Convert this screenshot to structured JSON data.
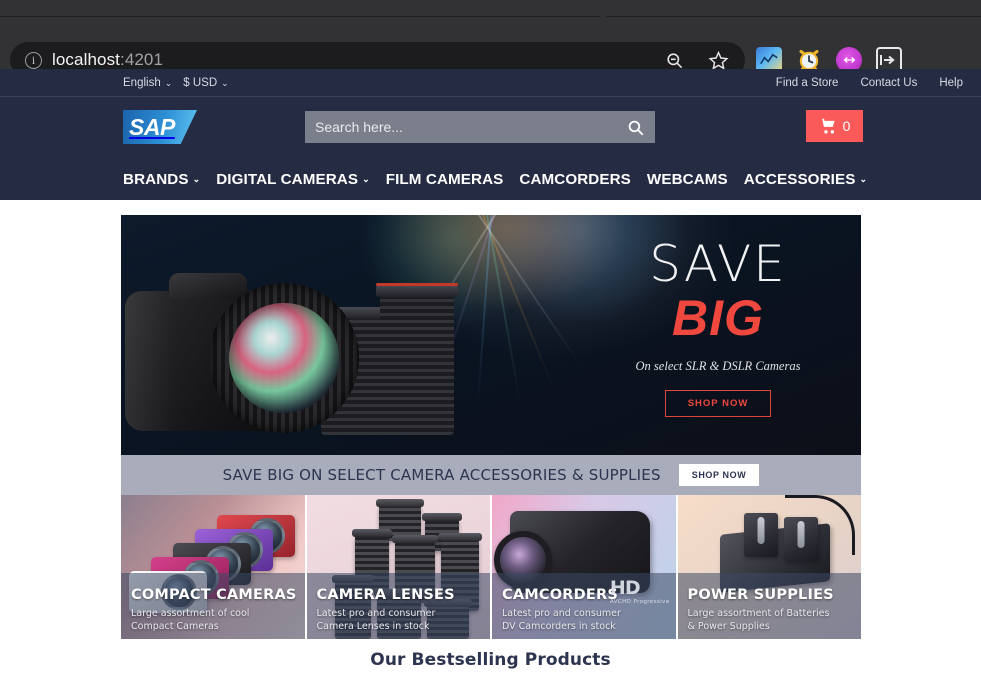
{
  "browser": {
    "url_host": "localhost",
    "url_port": ":4201",
    "site_info_icon": "info-icon",
    "zoom_out_icon": "zoom-out-icon",
    "bookmark_icon": "star-icon",
    "extensions": [
      {
        "name": "chart-extension-icon",
        "glyph": "↗"
      },
      {
        "name": "alarm-clock-extension-icon",
        "glyph": "⏰"
      },
      {
        "name": "purple-circle-extension-icon",
        "glyph": "↔"
      },
      {
        "name": "sidebar-toggle-icon",
        "glyph": "▏"
      }
    ]
  },
  "site": {
    "utility": {
      "language": "English",
      "currency": "$ USD",
      "caret": "⌄",
      "links": [
        "Find a Store",
        "Contact Us",
        "Help"
      ]
    },
    "logo_text": "SAP",
    "search": {
      "placeholder": "Search here...",
      "value": "",
      "icon": "search-icon"
    },
    "cart": {
      "icon": "shopping-cart-icon",
      "count": "0"
    },
    "nav": [
      {
        "label": "BRANDS",
        "caret": "⌄"
      },
      {
        "label": "DIGITAL CAMERAS",
        "caret": "⌄"
      },
      {
        "label": "FILM CAMERAS",
        "caret": ""
      },
      {
        "label": "CAMCORDERS",
        "caret": ""
      },
      {
        "label": "WEBCAMS",
        "caret": ""
      },
      {
        "label": "ACCESSORIES",
        "caret": "⌄"
      }
    ]
  },
  "hero": {
    "line1": "SAVE",
    "line2": "BIG",
    "subtitle": "On select SLR & DSLR Cameras",
    "cta": "SHOP NOW"
  },
  "promo": {
    "text": "SAVE BIG ON SELECT CAMERA ACCESSORIES & SUPPLIES",
    "cta": "SHOP NOW"
  },
  "tiles": [
    {
      "title": "COMPACT CAMERAS",
      "desc": "Large assortment of cool\nCompact Cameras"
    },
    {
      "title": "CAMERA LENSES",
      "desc": "Latest pro and consumer\nCamera Lenses in stock"
    },
    {
      "title": "CAMCORDERS",
      "desc": "Latest pro and consumer\nDV Camcorders in stock",
      "badge": "HD",
      "badge_sub": "AVCHD Progressive"
    },
    {
      "title": "POWER SUPPLIES",
      "desc": "Large assortment of Batteries\n& Power Supplies"
    }
  ],
  "bestsellers": {
    "heading": "Our Bestselling Products"
  },
  "colors": {
    "header_bg": "#252b42",
    "accent_red": "#fb5a5a",
    "hero_red": "#f0483e",
    "promo_bg": "#a9adbb",
    "search_bg": "#7b7f8c",
    "browser_chrome": "#323234",
    "urlbar_bg": "#1c1b1d"
  }
}
